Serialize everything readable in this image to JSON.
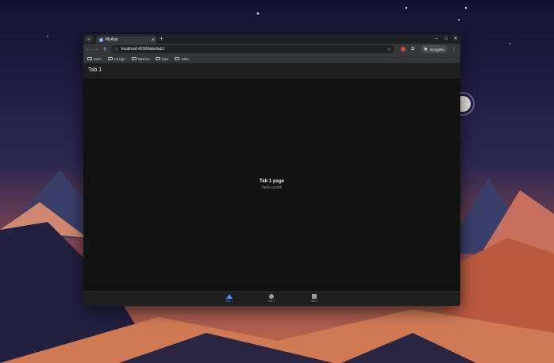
{
  "browser": {
    "tab_title": "MyApp",
    "new_tab": "+",
    "url": "localhost:4200/tabs/tab1",
    "incognito_label": "Incognito",
    "bookmarks": [
      "Main",
      "Design",
      "Metrics",
      "Dev",
      "Jobs"
    ]
  },
  "app": {
    "header_title": "Tab 1",
    "page_title": "Tab 1 page",
    "page_subtitle": "Hello world!",
    "tabs": [
      {
        "label": "Tab 1",
        "icon": "triangle-icon",
        "active": true
      },
      {
        "label": "Tab 2",
        "icon": "ellipse-icon",
        "active": false
      },
      {
        "label": "Tab 3",
        "icon": "square-icon",
        "active": false
      }
    ],
    "colors": {
      "active": "#4d8dff",
      "inactive": "#9a9a9a"
    }
  }
}
